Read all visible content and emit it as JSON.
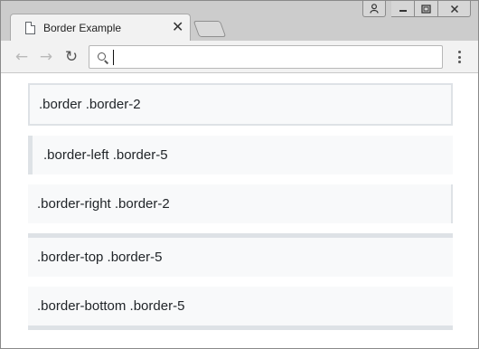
{
  "tab": {
    "title": "Border Example",
    "close_glyph": "✕",
    "icon": "page-icon"
  },
  "window_controls": {
    "user_glyph": "👤",
    "minimize_glyph": "—",
    "restore_glyph": "▭",
    "close_glyph": "✕"
  },
  "toolbar": {
    "back_glyph": "←",
    "forward_glyph": "→",
    "reload_glyph": "↻",
    "address_value": "",
    "menu_icon": "kebab-menu-icon"
  },
  "boxes": [
    {
      "label": ".border .border-2"
    },
    {
      "label": ".border-left .border-5"
    },
    {
      "label": ".border-right .border-2"
    },
    {
      "label": ".border-top .border-5"
    },
    {
      "label": ".border-bottom .border-5"
    }
  ],
  "colors": {
    "border": "#dee2e6",
    "box_bg": "#f8f9fa",
    "text": "#212529"
  }
}
